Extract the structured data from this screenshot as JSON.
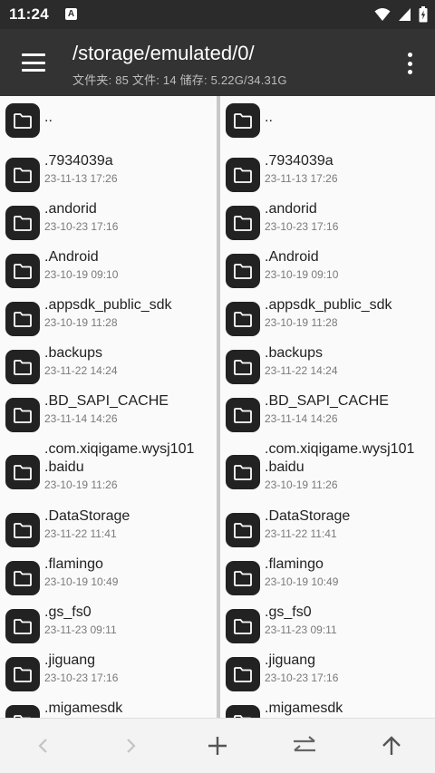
{
  "status": {
    "time": "11:24",
    "a_badge": "A"
  },
  "appbar": {
    "path": "/storage/emulated/0/",
    "info": "文件夹: 85  文件: 14  储存: 5.22G/34.31G"
  },
  "left_pane": [
    {
      "name": "..",
      "date": ""
    },
    {
      "name": ".7934039a",
      "date": "23-11-13 17:26"
    },
    {
      "name": ".andorid",
      "date": "23-10-23 17:16"
    },
    {
      "name": ".Android",
      "date": "23-10-19 09:10"
    },
    {
      "name": ".appsdk_public_sdk",
      "date": "23-10-19 11:28"
    },
    {
      "name": ".backups",
      "date": "23-11-22 14:24"
    },
    {
      "name": ".BD_SAPI_CACHE",
      "date": "23-11-14 14:26"
    },
    {
      "name": ".com.xiqigame.wysj101",
      "name2": ".baidu",
      "date": "23-10-19 11:26"
    },
    {
      "name": ".DataStorage",
      "date": "23-11-22 11:41"
    },
    {
      "name": ".flamingo",
      "date": "23-10-19 10:49"
    },
    {
      "name": ".gs_fs0",
      "date": "23-11-23 09:11"
    },
    {
      "name": ".jiguang",
      "date": "23-10-23 17:16"
    },
    {
      "name": ".migamesdk",
      "date": ""
    }
  ],
  "right_pane": [
    {
      "name": "..",
      "date": ""
    },
    {
      "name": ".7934039a",
      "date": "23-11-13 17:26"
    },
    {
      "name": ".andorid",
      "date": "23-10-23 17:16"
    },
    {
      "name": ".Android",
      "date": "23-10-19 09:10"
    },
    {
      "name": ".appsdk_public_sdk",
      "date": "23-10-19 11:28"
    },
    {
      "name": ".backups",
      "date": "23-11-22 14:24"
    },
    {
      "name": ".BD_SAPI_CACHE",
      "date": "23-11-14 14:26"
    },
    {
      "name": ".com.xiqigame.wysj101",
      "name2": ".baidu",
      "date": "23-10-19 11:26"
    },
    {
      "name": ".DataStorage",
      "date": "23-11-22 11:41"
    },
    {
      "name": ".flamingo",
      "date": "23-10-19 10:49"
    },
    {
      "name": ".gs_fs0",
      "date": "23-11-23 09:11"
    },
    {
      "name": ".jiguang",
      "date": "23-10-23 17:16"
    },
    {
      "name": ".migamesdk",
      "date": ""
    }
  ],
  "icons": {
    "back": "chevron-left-icon",
    "forward": "chevron-right-icon",
    "add": "plus-icon",
    "swap": "swap-icon",
    "up": "arrow-up-icon"
  },
  "colors": {
    "appbar": "#333333",
    "folder": "#222222",
    "date": "#7a7a7a"
  }
}
